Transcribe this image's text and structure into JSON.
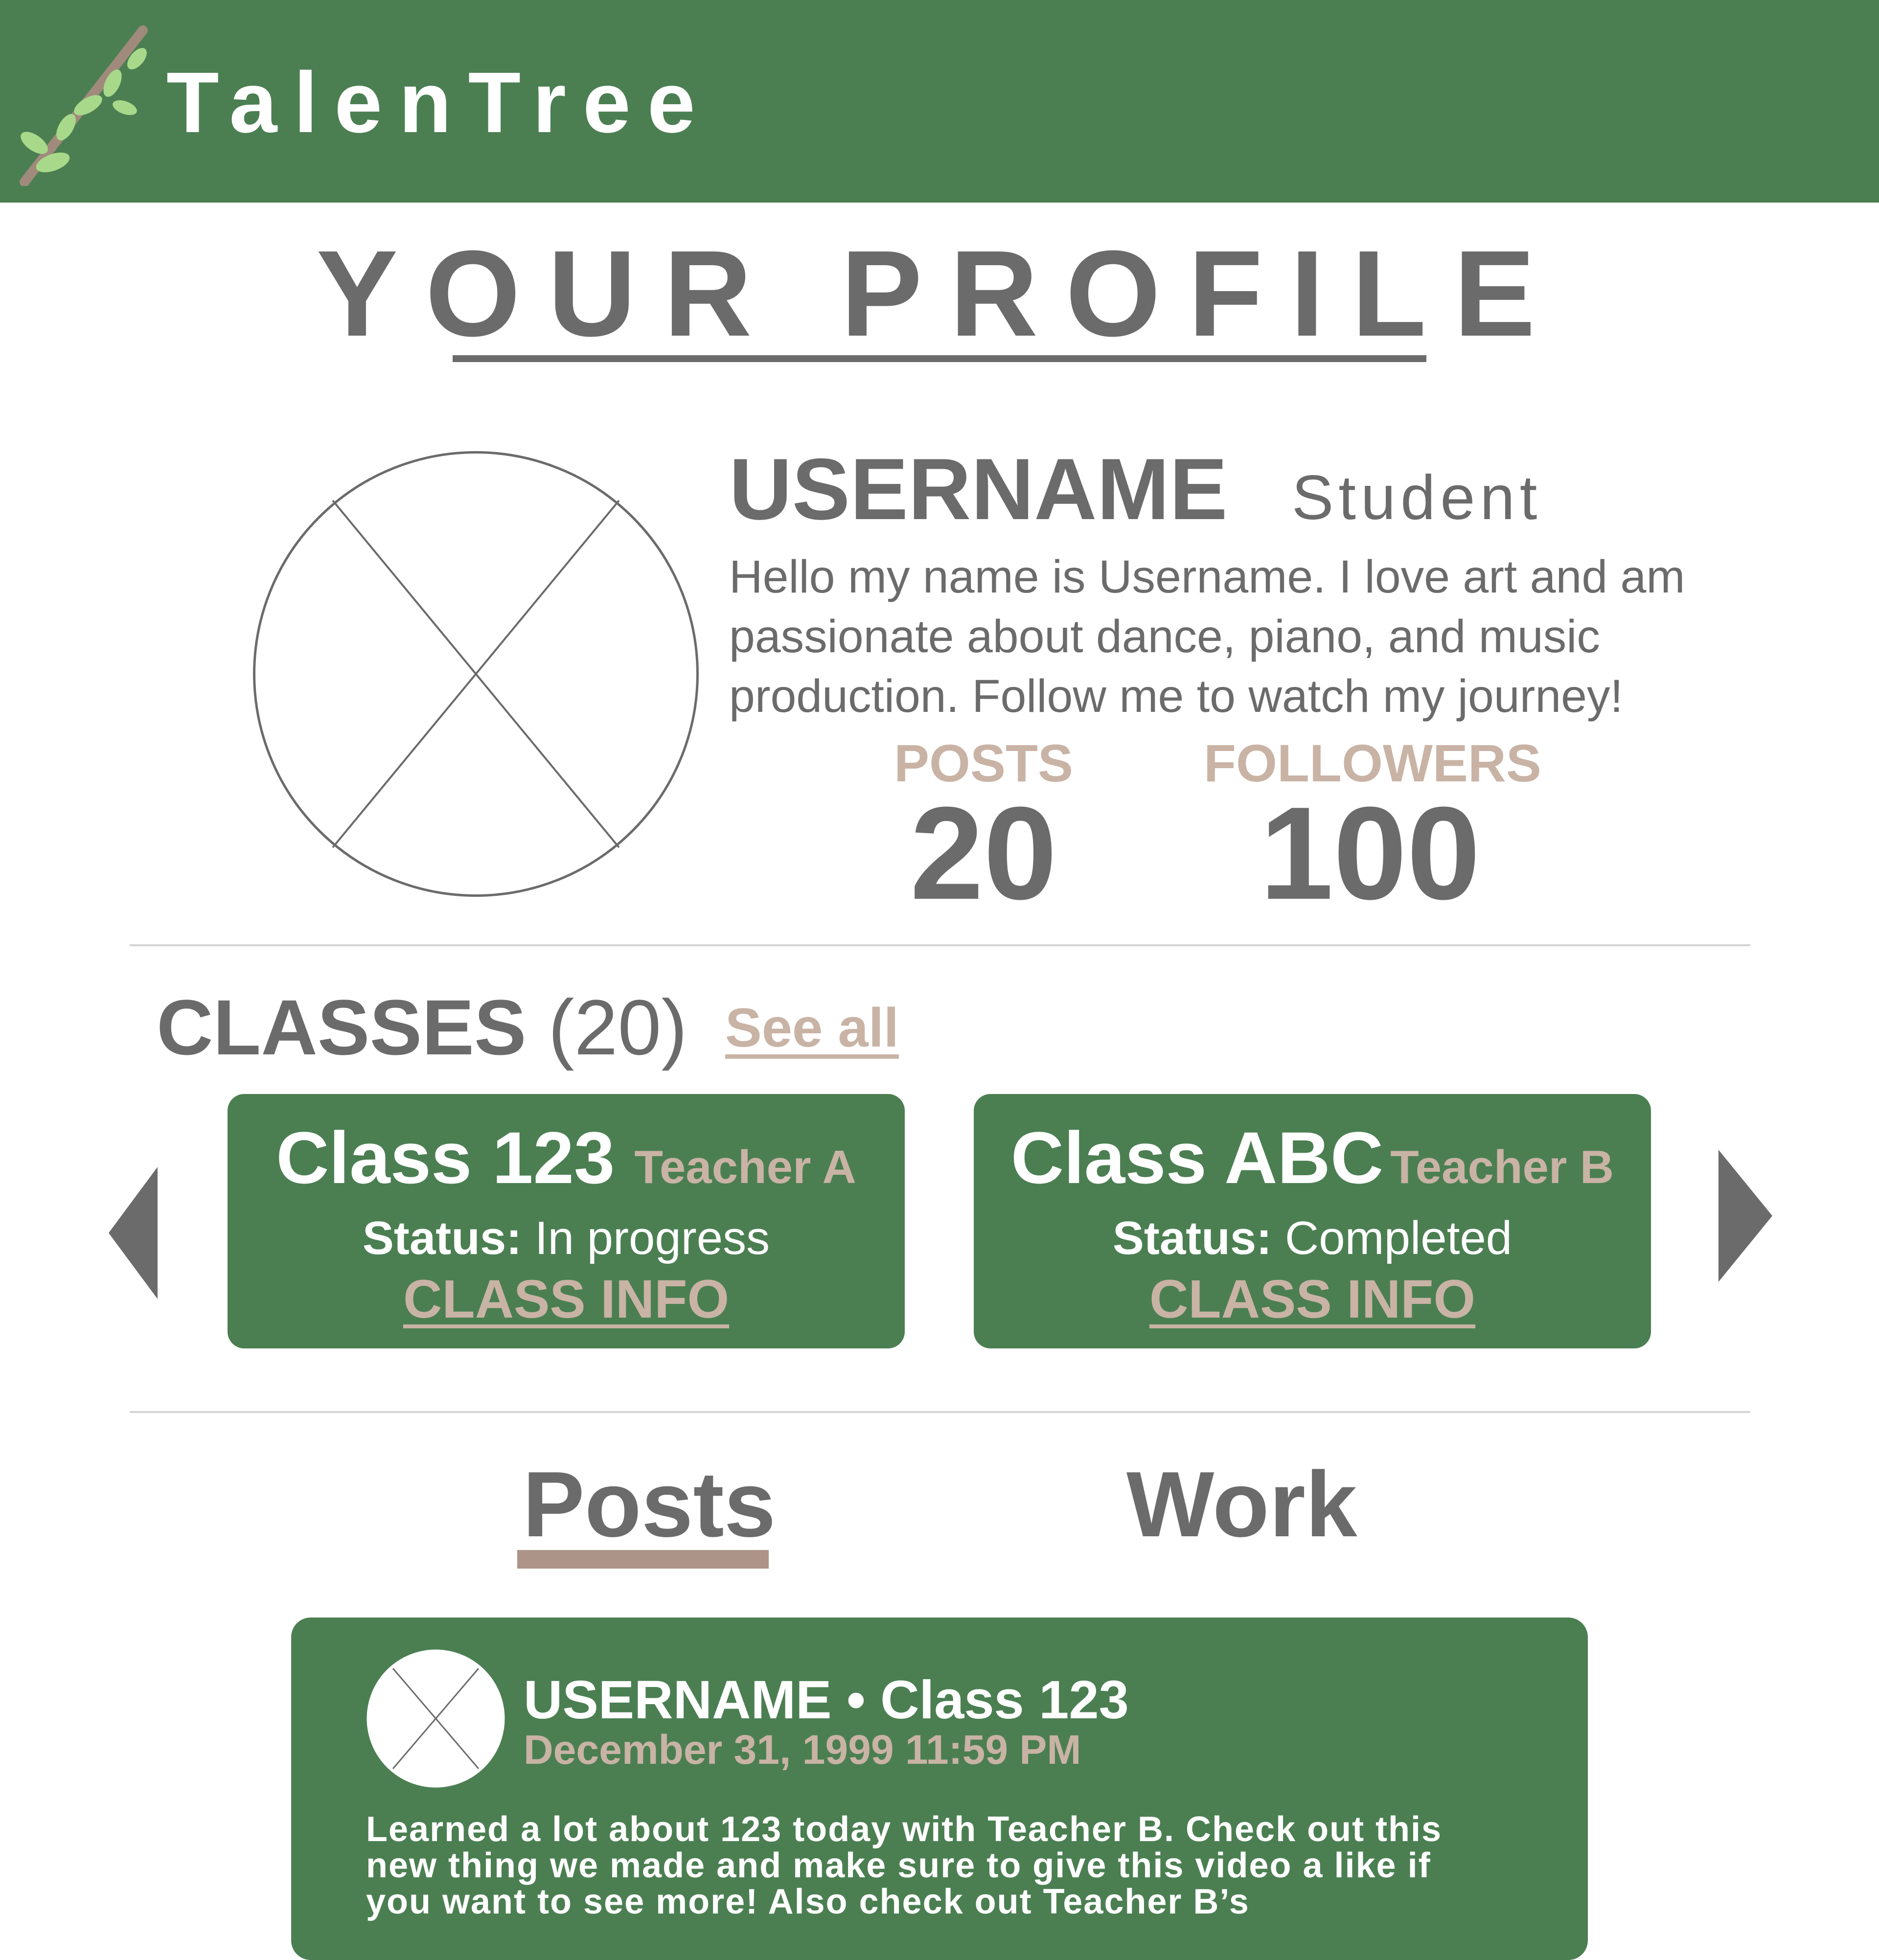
{
  "header": {
    "brand": "TalenTree",
    "logo_icon": "branch-icon",
    "bg_color": "#4b7f52"
  },
  "page_title": "YOUR PROFILE",
  "profile": {
    "username": "USERNAME",
    "role": "Student",
    "bio": "Hello my name is Username. I love art and am passionate about dance, piano, and music production. Follow me to watch my journey!",
    "avatar_icon": "image-placeholder-icon",
    "stats": {
      "posts_label": "POSTS",
      "posts_value": "20",
      "followers_label": "FOLLOWERS",
      "followers_value": "100"
    }
  },
  "classes": {
    "heading": "CLASSES",
    "count": "(20)",
    "see_all": "See all",
    "prev_icon": "triangle-left-icon",
    "next_icon": "triangle-right-icon",
    "status_label": "Status:",
    "items": [
      {
        "name": "Class 123",
        "teacher": "Teacher A",
        "status": "In progress",
        "link": "CLASS INFO"
      },
      {
        "name": "Class ABC",
        "teacher": "Teacher B",
        "status": "Completed",
        "link": "CLASS INFO"
      }
    ]
  },
  "tabs": {
    "posts": "Posts",
    "work": "Work",
    "active": "Posts"
  },
  "post": {
    "author": "USERNAME",
    "separator": "•",
    "class_name": "Class 123",
    "date": "December 31, 1999 11:59 PM",
    "body": "Learned a lot about 123 today with Teacher B. Check out this new thing we made and make sure to give this video a like if you want to see more! Also check out Teacher B’s"
  },
  "colors": {
    "primary_green": "#4b7f52",
    "accent_tan": "#c9b3a5",
    "text_gray": "#6b6b6b",
    "tab_underline": "#ad9488"
  }
}
